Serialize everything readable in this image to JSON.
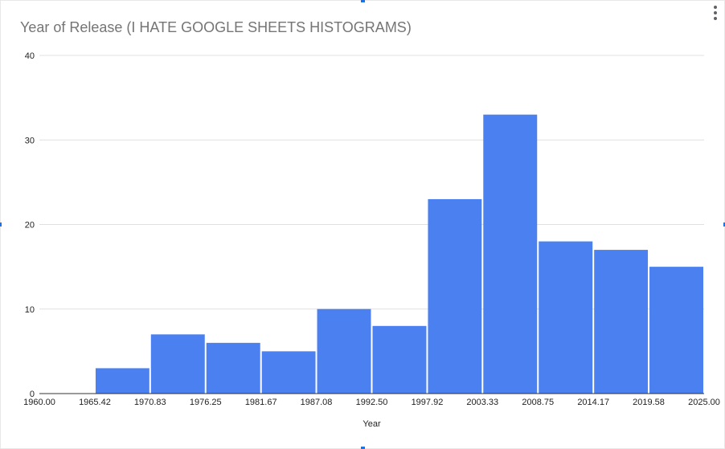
{
  "chart_data": {
    "type": "bar",
    "title": "Year of Release (I HATE GOOGLE SHEETS HISTOGRAMS)",
    "xlabel": "Year",
    "ylabel": "",
    "x_ticks": [
      "1960.00",
      "1965.42",
      "1970.83",
      "1976.25",
      "1981.67",
      "1987.08",
      "1992.50",
      "1997.92",
      "2003.33",
      "2008.75",
      "2014.17",
      "2019.58",
      "2025.00"
    ],
    "y_ticks": [
      "0",
      "10",
      "20",
      "30",
      "40"
    ],
    "bins": [
      {
        "from": 1960.0,
        "to": 1965.42,
        "count": 0
      },
      {
        "from": 1965.42,
        "to": 1970.83,
        "count": 3
      },
      {
        "from": 1970.83,
        "to": 1976.25,
        "count": 7
      },
      {
        "from": 1976.25,
        "to": 1981.67,
        "count": 6
      },
      {
        "from": 1981.67,
        "to": 1987.08,
        "count": 5
      },
      {
        "from": 1987.08,
        "to": 1992.5,
        "count": 10
      },
      {
        "from": 1992.5,
        "to": 1997.92,
        "count": 8
      },
      {
        "from": 1997.92,
        "to": 2003.33,
        "count": 23
      },
      {
        "from": 2003.33,
        "to": 2008.75,
        "count": 33
      },
      {
        "from": 2008.75,
        "to": 2014.17,
        "count": 18
      },
      {
        "from": 2014.17,
        "to": 2019.58,
        "count": 17
      },
      {
        "from": 2019.58,
        "to": 2025.0,
        "count": 15
      }
    ],
    "ylim": [
      0,
      40
    ],
    "xlim": [
      1960.0,
      2025.0
    ],
    "grid": true,
    "bar_color": "#4a80ef",
    "grid_color": "#e0e0e0",
    "axis_color": "#333333"
  }
}
